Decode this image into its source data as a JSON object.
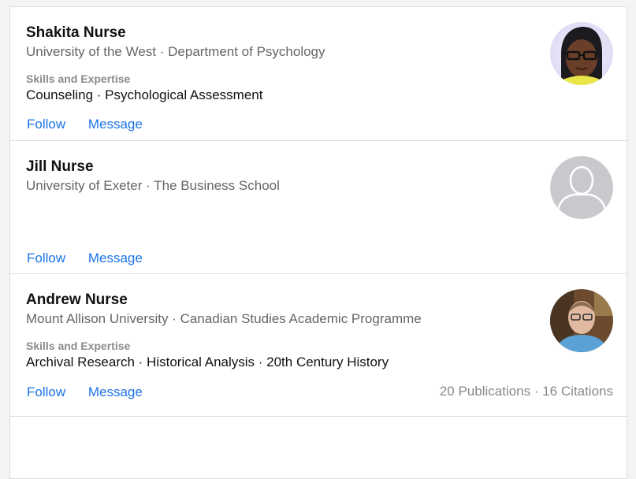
{
  "people": [
    {
      "name": "Shakita Nurse",
      "affiliation": "University of the West · Department of Psychology",
      "skills_label": "Skills and Expertise",
      "skills": "Counseling · Psychological Assessment",
      "follow": "Follow",
      "message": "Message"
    },
    {
      "name": "Jill Nurse",
      "affiliation": "University of Exeter · The Business School",
      "follow": "Follow",
      "message": "Message"
    },
    {
      "name": "Andrew Nurse",
      "affiliation": "Mount Allison University · Canadian Studies Academic Programme",
      "skills_label": "Skills and Expertise",
      "skills": "Archival Research · Historical Analysis · 20th Century History",
      "follow": "Follow",
      "message": "Message",
      "stats": "20 Publications · 16 Citations"
    }
  ],
  "colors": {
    "link": "#1a73e8",
    "muted": "#666666",
    "border": "#dcdcdc",
    "placeholder_avatar": "#c7c9cc"
  },
  "icons": {
    "placeholder_avatar": "user-silhouette-icon"
  }
}
